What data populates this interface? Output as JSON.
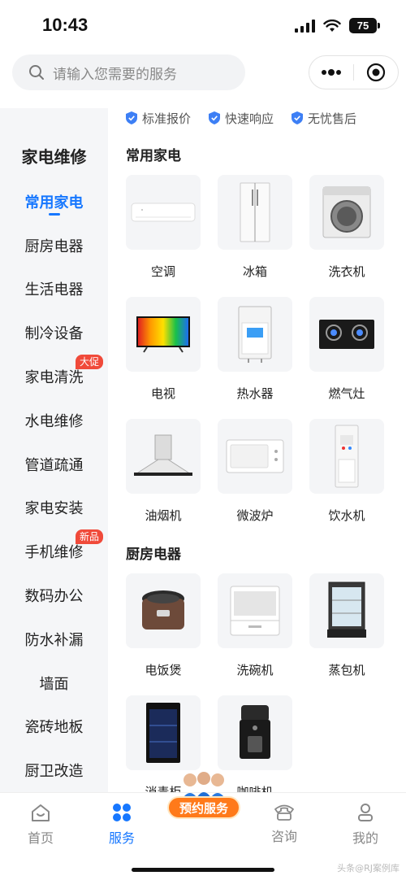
{
  "status": {
    "time": "10:43",
    "battery": "75"
  },
  "search": {
    "placeholder": "请输入您需要的服务"
  },
  "sidebar": {
    "header": "家电维修",
    "items": [
      {
        "label": "常用家电",
        "active": true
      },
      {
        "label": "厨房电器"
      },
      {
        "label": "生活电器"
      },
      {
        "label": "制冷设备"
      },
      {
        "label": "家电清洗",
        "badge": "大促"
      },
      {
        "label": "水电维修"
      },
      {
        "label": "管道疏通"
      },
      {
        "label": "家电安装"
      },
      {
        "label": "手机维修",
        "badge": "新品"
      },
      {
        "label": "数码办公"
      },
      {
        "label": "防水补漏"
      },
      {
        "label": "墙面"
      },
      {
        "label": "瓷砖地板"
      },
      {
        "label": "厨卫改造"
      }
    ]
  },
  "guarantees": [
    "标准报价",
    "快速响应",
    "无忧售后"
  ],
  "sections": [
    {
      "title": "常用家电",
      "items": [
        {
          "label": "空调",
          "icon": "air-conditioner"
        },
        {
          "label": "冰箱",
          "icon": "refrigerator"
        },
        {
          "label": "洗衣机",
          "icon": "washing-machine"
        },
        {
          "label": "电视",
          "icon": "television"
        },
        {
          "label": "热水器",
          "icon": "water-heater"
        },
        {
          "label": "燃气灶",
          "icon": "gas-stove"
        },
        {
          "label": "油烟机",
          "icon": "range-hood"
        },
        {
          "label": "微波炉",
          "icon": "microwave"
        },
        {
          "label": "饮水机",
          "icon": "water-dispenser"
        }
      ]
    },
    {
      "title": "厨房电器",
      "items": [
        {
          "label": "电饭煲",
          "icon": "rice-cooker"
        },
        {
          "label": "洗碗机",
          "icon": "dishwasher"
        },
        {
          "label": "蒸包机",
          "icon": "bun-steamer"
        },
        {
          "label": "消毒柜",
          "icon": "sterilizer-cabinet"
        },
        {
          "label": "咖啡机",
          "icon": "coffee-machine"
        }
      ]
    }
  ],
  "tabbar": {
    "items": [
      {
        "label": "首页",
        "icon": "home-icon"
      },
      {
        "label": "服务",
        "icon": "services-icon",
        "active": true
      },
      {
        "label": "咨询",
        "icon": "phone-icon"
      },
      {
        "label": "我的",
        "icon": "profile-icon"
      }
    ],
    "promo": "预约服务"
  },
  "watermark": "头条@RJ案例库",
  "colors": {
    "accent": "#1677ff",
    "badge": "#f04a3a",
    "promo": "#ff7a1a"
  }
}
